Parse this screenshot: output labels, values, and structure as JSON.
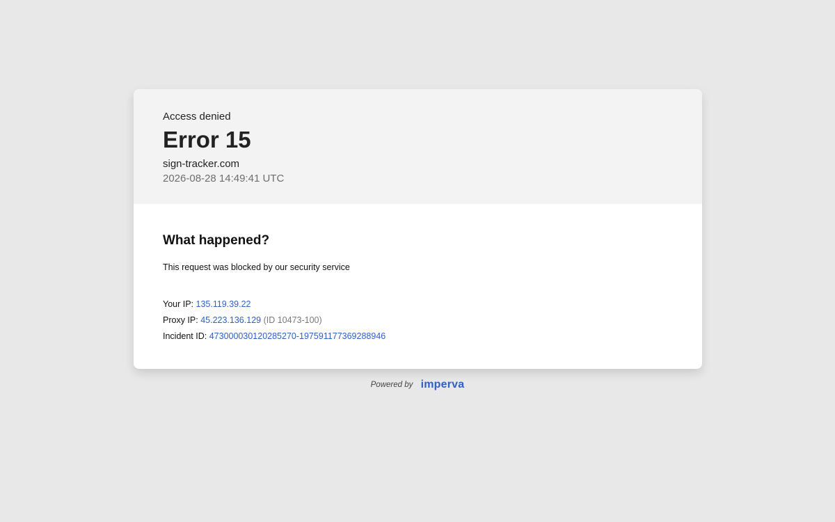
{
  "header": {
    "subtitle": "Access denied",
    "title": "Error 15",
    "domain": "sign-tracker.com",
    "timestamp": "2026-08-28 14:49:41 UTC"
  },
  "body": {
    "heading": "What happened?",
    "explanation": "This request was blocked by our security service",
    "details": {
      "your_ip_label": "Your IP:",
      "your_ip_value": "135.119.39.22",
      "proxy_ip_label": "Proxy IP:",
      "proxy_ip_value": "45.223.136.129",
      "proxy_ip_id": "(ID 10473-100)",
      "incident_id_label": "Incident ID:",
      "incident_id_value": "473000030120285270-197591177369288946"
    }
  },
  "footer": {
    "powered_by": "Powered by",
    "brand": "imperva"
  },
  "colors": {
    "background": "#e8e8e8",
    "header_background": "#f3f3f3",
    "link": "#2f5fc9",
    "muted": "#7a7a7a"
  }
}
